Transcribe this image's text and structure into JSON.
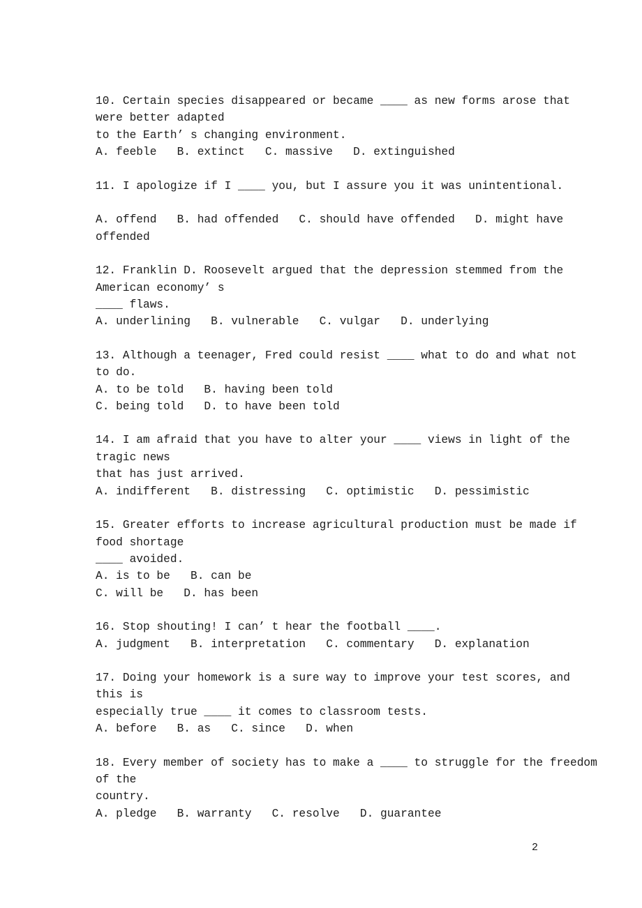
{
  "document": {
    "page_number": "2",
    "questions": [
      {
        "number": "10",
        "lines": [
          "10. Certain species disappeared or became ____ as new forms arose that",
          "were better adapted",
          "to the Earth’ s changing environment.",
          "A. feeble   B. extinct   C. massive   D. extinguished"
        ]
      },
      {
        "number": "11",
        "lines": [
          "11. I apologize if I ____ you, but I assure you it was unintentional.",
          "",
          "A. offend   B. had offended   C. should have offended   D. might have",
          "offended"
        ]
      },
      {
        "number": "12",
        "lines": [
          "12. Franklin D. Roosevelt argued that the depression stemmed from the",
          "American economy’ s",
          "____ flaws.",
          "A. underlining   B. vulnerable   C. vulgar   D. underlying"
        ]
      },
      {
        "number": "13",
        "lines": [
          "13. Although a teenager, Fred could resist ____ what to do and what not",
          "to do.",
          "A. to be told   B. having been told",
          "C. being told   D. to have been told"
        ]
      },
      {
        "number": "14",
        "lines": [
          "14. I am afraid that you have to alter your ____ views in light of the",
          "tragic news",
          "that has just arrived.",
          "A. indifferent   B. distressing   C. optimistic   D. pessimistic"
        ]
      },
      {
        "number": "15",
        "lines": [
          "15. Greater efforts to increase agricultural production must be made if",
          "food shortage",
          "____ avoided.",
          "A. is to be   B. can be",
          "C. will be   D. has been"
        ]
      },
      {
        "number": "16",
        "lines": [
          "16. Stop shouting! I can’ t hear the football ____.",
          "A. judgment   B. interpretation   C. commentary   D. explanation"
        ]
      },
      {
        "number": "17",
        "lines": [
          "17. Doing your homework is a sure way to improve your test scores, and",
          "this is",
          "especially true ____ it comes to classroom tests.",
          "A. before   B. as   C. since   D. when"
        ]
      },
      {
        "number": "18",
        "lines": [
          "18. Every member of society has to make a ____ to struggle for the freedom",
          "of the",
          "country.",
          "A. pledge   B. warranty   C. resolve   D. guarantee"
        ]
      }
    ]
  }
}
